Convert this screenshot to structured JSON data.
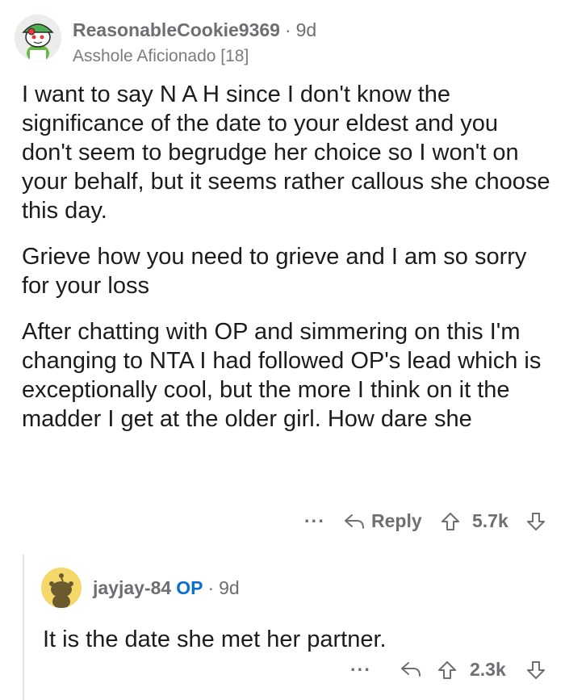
{
  "top_comment": {
    "username": "ReasonableCookie9369",
    "time": "9d",
    "flair": "Asshole Aficionado [18]",
    "paragraphs": [
      "I want to say N A H since I don't know the significance of the date to your eldest and you don't seem to begrudge her choice so I won't on your behalf, but it seems rather callous she choose this day.",
      "Grieve how you need to grieve and I am so sorry for your loss",
      "After chatting with OP and simmering on this I'm changing to NTA I had followed OP's lead which is exceptionally cool, but the more I think on it the madder I get at the older girl. How dare she"
    ],
    "actions": {
      "more": "···",
      "reply_label": "Reply",
      "score": "5.7k"
    },
    "icons": {
      "avatar": "snoo-avatar-green-hat",
      "reply": "reply-arrow-icon",
      "upvote": "upvote-arrow-icon",
      "downvote": "downvote-arrow-icon"
    }
  },
  "reply_comment": {
    "username": "jayjay-84",
    "op_badge": "OP",
    "time": "9d",
    "text": "It is the date she met her partner.",
    "actions": {
      "more": "···",
      "score": "2.3k"
    },
    "icons": {
      "avatar": "snoo-avatar-default",
      "reply": "reply-arrow-icon",
      "upvote": "upvote-arrow-icon",
      "downvote": "downvote-arrow-icon"
    }
  },
  "colors": {
    "text": "#1c1c1e",
    "meta": "#6e6e73",
    "op": "#0a6fcf",
    "thread_line": "#e2e2e5"
  }
}
